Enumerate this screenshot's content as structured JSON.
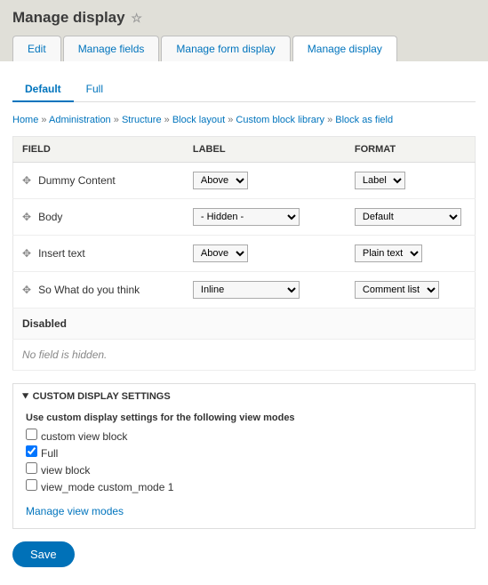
{
  "page_title": "Manage display",
  "primary_tabs": {
    "t0": "Edit",
    "t1": "Manage fields",
    "t2": "Manage form display",
    "t3": "Manage display"
  },
  "secondary_tabs": {
    "t0": "Default",
    "t1": "Full"
  },
  "breadcrumb": {
    "b0": "Home",
    "b1": "Administration",
    "b2": "Structure",
    "b3": "Block layout",
    "b4": "Custom block library",
    "b5": "Block as field"
  },
  "table": {
    "headers": {
      "field": "FIELD",
      "label": "LABEL",
      "format": "FORMAT"
    },
    "rows": {
      "r0": {
        "field": "Dummy Content",
        "label": "Above",
        "format": "Label"
      },
      "r1": {
        "field": "Body",
        "label": "- Hidden -",
        "format": "Default"
      },
      "r2": {
        "field": "Insert text",
        "label": "Above",
        "format": "Plain text"
      },
      "r3": {
        "field": "So What do you think",
        "label": "Inline",
        "format": "Comment list"
      }
    },
    "disabled_heading": "Disabled",
    "disabled_note": "No field is hidden."
  },
  "custom": {
    "summary": "CUSTOM DISPLAY SETTINGS",
    "subheading": "Use custom display settings for the following view modes",
    "modes": {
      "m0": "custom view block",
      "m1": "Full",
      "m2": "view block",
      "m3": "view_mode custom_mode 1"
    },
    "manage_link": "Manage view modes"
  },
  "save_label": "Save"
}
